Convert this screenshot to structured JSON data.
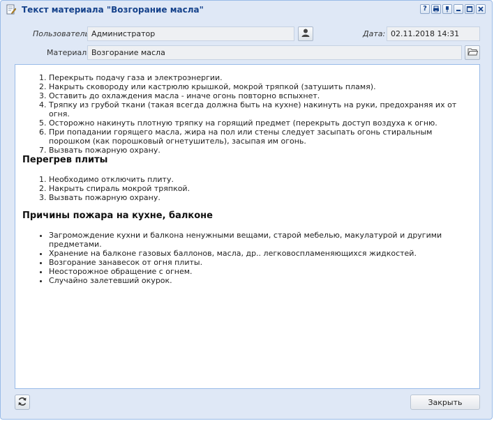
{
  "window": {
    "title": "Текст материала \"Возгорание масла\"",
    "tools": [
      "?",
      "▥",
      "❚",
      "—",
      "☐",
      "✕"
    ]
  },
  "form": {
    "user_label": "Пользователь:",
    "user_value": "Администратор",
    "date_label": "Дата:",
    "date_value": "02.11.2018 14:31",
    "material_label": "Материал:",
    "material_value": "Возгорание масла"
  },
  "content": {
    "list1": [
      "Перекрыть подачу газа и электроэнергии.",
      "Накрыть сковороду или кастрюлю крышкой, мокрой тряпкой (затушить пламя).",
      "Оставить до охлаждения масла - иначе огонь повторно вспыхнет.",
      "Тряпку из грубой ткани (такая всегда должна быть на кухне) накинуть на руки, предохраняя их от огня.",
      "Осторожно накинуть плотную тряпку на горящий предмет (перекрыть доступ воздуха к огню.",
      "При попадании горящего масла, жира на пол или стены следует  засыпать огонь стиральным порошком (как порошковый огнетушитель), засыпая им огонь.",
      "Вызвать пожарную охрану."
    ],
    "heading2": "Перегрев плиты",
    "list2": [
      "Необходимо отключить плиту.",
      "Накрыть спираль мокрой тряпкой.",
      "Вызвать пожарную охрану."
    ],
    "heading3": "Причины пожара на кухне, балконе",
    "list3": [
      "Загромождение кухни и балкона ненужными вещами, старой мебелью, макулатурой и другими предметами.",
      "Хранение на балконе газовых баллонов, масла, др.. легковоспламеняющихся жидкостей.",
      "Возгорание занавесок от огня плиты.",
      "Неосторожное обращение с огнем.",
      "Случайно залетевший окурок."
    ]
  },
  "buttons": {
    "close_label": "Закрыть"
  }
}
